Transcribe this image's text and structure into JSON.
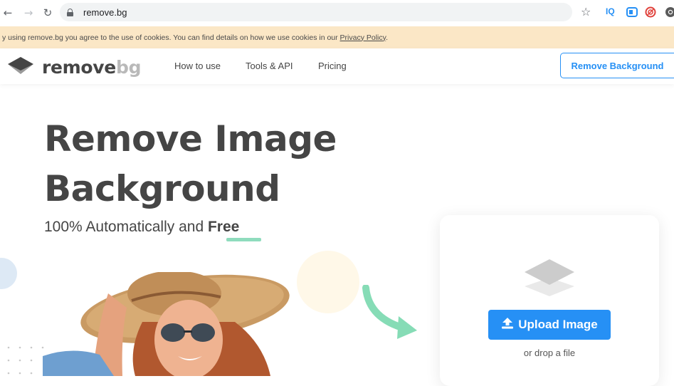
{
  "browser": {
    "url": "remove.bg",
    "extensions": [
      "IQ",
      "tab-icon",
      "no-icon",
      "chrome-profile-icon"
    ]
  },
  "cookie_banner": {
    "text": "y using remove.bg you agree to the use of cookies. You can find details on how we use cookies in our ",
    "link": "Privacy Policy",
    "suffix": "."
  },
  "header": {
    "logo_main": "remove",
    "logo_accent": "bg",
    "nav": [
      "How to use",
      "Tools & API",
      "Pricing"
    ],
    "cta": "Remove Background"
  },
  "hero": {
    "title_line1": "Remove Image",
    "title_line2": "Background",
    "subtitle_prefix": "100% Automatically and ",
    "subtitle_bold": "Free"
  },
  "upload": {
    "button": "Upload Image",
    "drop_text": "or drop a file"
  },
  "colors": {
    "accent_blue": "#2690f5",
    "cookie_bg": "#fbe7c6",
    "underline_green": "#8fdcbd",
    "arrow_green": "#86dcb6"
  }
}
